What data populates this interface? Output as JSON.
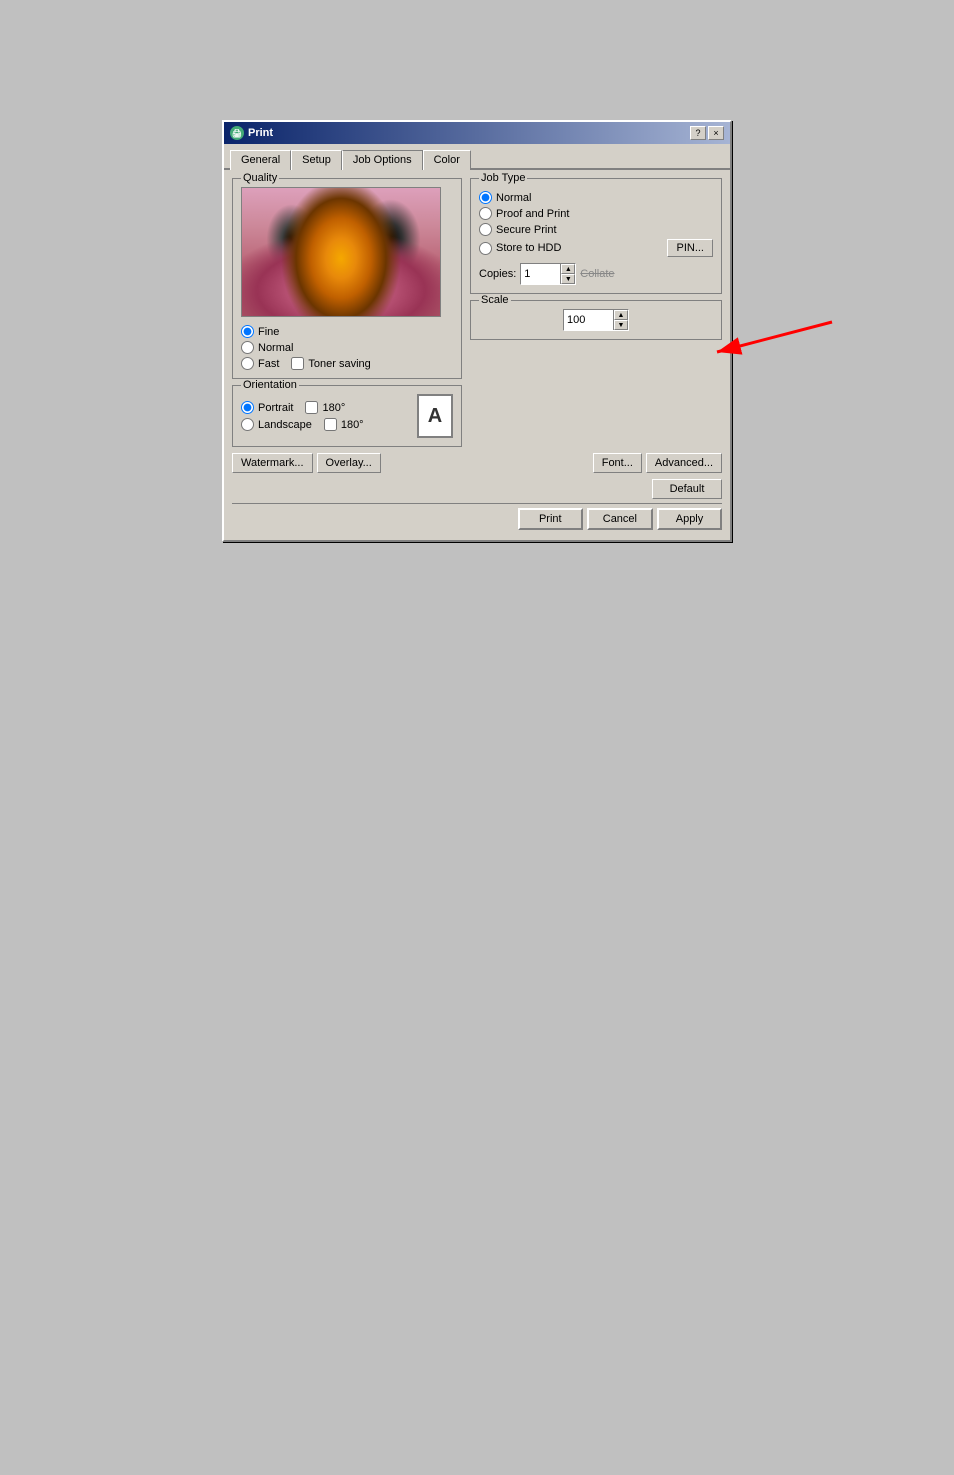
{
  "window": {
    "title": "Print",
    "help_btn": "?",
    "close_btn": "×"
  },
  "tabs": [
    {
      "label": "General",
      "active": false
    },
    {
      "label": "Setup",
      "active": false
    },
    {
      "label": "Job Options",
      "active": true
    },
    {
      "label": "Color",
      "active": false
    }
  ],
  "quality": {
    "group_label": "Quality",
    "options": [
      {
        "id": "fine",
        "label": "Fine",
        "checked": true
      },
      {
        "id": "normal",
        "label": "Normal",
        "checked": false
      },
      {
        "id": "fast",
        "label": "Fast",
        "checked": false
      }
    ],
    "toner_saving": {
      "label": "Toner saving",
      "checked": false
    }
  },
  "orientation": {
    "group_label": "Orientation",
    "portrait": {
      "label": "Portrait",
      "checked": true,
      "deg_label": "180°",
      "deg_checked": false
    },
    "landscape": {
      "label": "Landscape",
      "checked": false,
      "deg_label": "180°",
      "deg_checked": false
    },
    "page_icon": "A"
  },
  "job_type": {
    "group_label": "Job Type",
    "options": [
      {
        "id": "normal",
        "label": "Normal",
        "checked": true
      },
      {
        "id": "proof",
        "label": "Proof and Print",
        "checked": false
      },
      {
        "id": "secure",
        "label": "Secure Print",
        "checked": false
      },
      {
        "id": "store",
        "label": "Store to HDD",
        "checked": false
      }
    ],
    "pin_btn": "PIN...",
    "copies_label": "Copies:",
    "copies_value": "1",
    "collate_label": "Collate"
  },
  "scale": {
    "group_label": "Scale",
    "value": "100"
  },
  "bottom_buttons": {
    "watermark": "Watermark...",
    "overlay": "Overlay...",
    "font": "Font...",
    "advanced": "Advanced...",
    "default": "Default"
  },
  "action_buttons": {
    "print": "Print",
    "cancel": "Cancel",
    "apply": "Apply"
  }
}
